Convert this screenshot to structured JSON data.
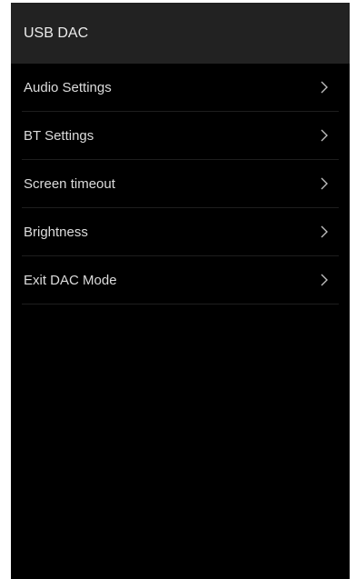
{
  "header": {
    "title": "USB DAC"
  },
  "menu": {
    "items": [
      {
        "label": "Audio Settings",
        "icon": "chevron-right-icon"
      },
      {
        "label": "BT Settings",
        "icon": "chevron-right-icon"
      },
      {
        "label": "Screen timeout",
        "icon": "chevron-right-icon"
      },
      {
        "label": "Brightness",
        "icon": "chevron-right-icon"
      },
      {
        "label": "Exit DAC Mode",
        "icon": "chevron-right-icon"
      }
    ]
  },
  "colors": {
    "background": "#000000",
    "header_background": "#222222",
    "text": "#dcdcdc",
    "divider": "#1e1e1e"
  }
}
